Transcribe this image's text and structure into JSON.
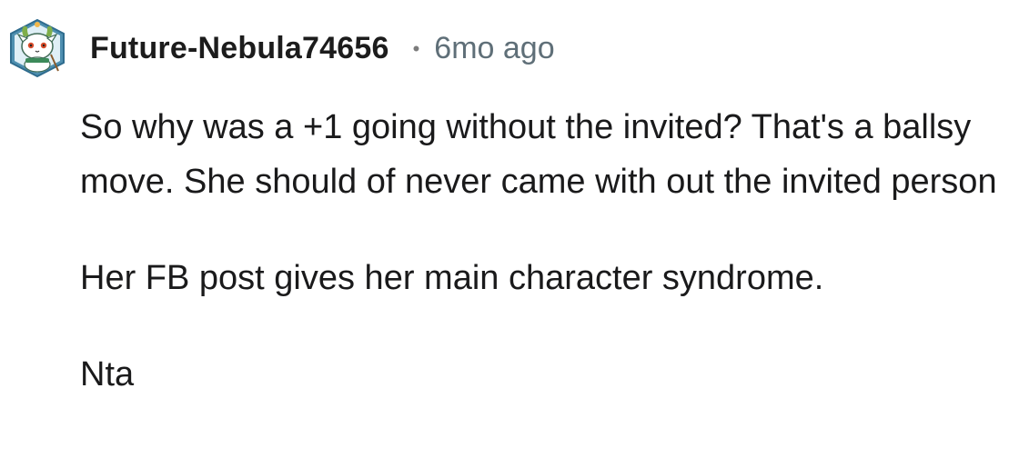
{
  "comment": {
    "author": "Future-Nebula74656",
    "separator": "•",
    "age": "6mo ago",
    "avatar_icon": "snow-creature-avatar-icon",
    "paragraphs": [
      "So why was a +1 going without the invited? That's a ballsy move. She should of never came with out the invited person",
      "Her FB post gives her main character syndrome.",
      "Nta"
    ]
  }
}
